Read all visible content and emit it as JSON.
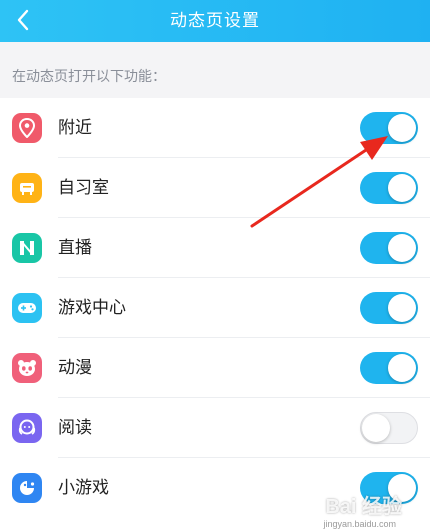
{
  "header": {
    "title": "动态页设置",
    "back_icon": "chevron-left-icon"
  },
  "section_label": "在动态页打开以下功能：",
  "items": [
    {
      "label": "附近",
      "icon": "location-pin-icon",
      "color": "#f05a6a",
      "enabled": true
    },
    {
      "label": "自习室",
      "icon": "study-room-icon",
      "color": "#ffb316",
      "enabled": true
    },
    {
      "label": "直播",
      "icon": "live-icon",
      "color": "#19c6a6",
      "enabled": true
    },
    {
      "label": "游戏中心",
      "icon": "gamepad-icon",
      "color": "#2cc2f2",
      "enabled": true
    },
    {
      "label": "动漫",
      "icon": "panda-icon",
      "color": "#f0607a",
      "enabled": true
    },
    {
      "label": "阅读",
      "icon": "reading-icon",
      "color": "#7a66f0",
      "enabled": false
    },
    {
      "label": "小游戏",
      "icon": "mini-game-icon",
      "color": "#2f86f2",
      "enabled": true
    }
  ],
  "accent_color": "#1fb4ee",
  "watermark": {
    "text": "Bai 经验",
    "sub": "jingyan.baidu.com"
  }
}
